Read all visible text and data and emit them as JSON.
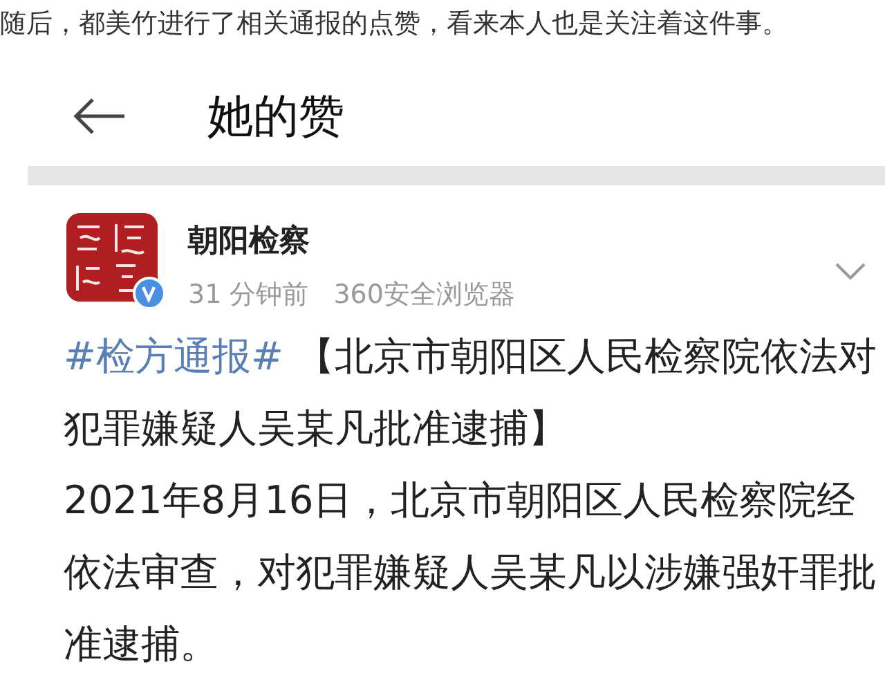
{
  "caption": "随后，都美竹进行了相关通报的点赞，看来本人也是关注着这件事。",
  "header": {
    "title": "她的赞"
  },
  "post": {
    "author": "朝阳检察",
    "verified": true,
    "time": "31 分钟前",
    "source": "360安全浏览器",
    "hashtag": "#检方通报#",
    "headline": "【北京市朝阳区人民检察院依法对犯罪嫌疑人吴某凡批准逮捕】",
    "body": "2021年8月16日，北京市朝阳区人民检察院经依法审查，对犯罪嫌疑人吴某凡以涉嫌强奸罪批准逮捕。"
  }
}
